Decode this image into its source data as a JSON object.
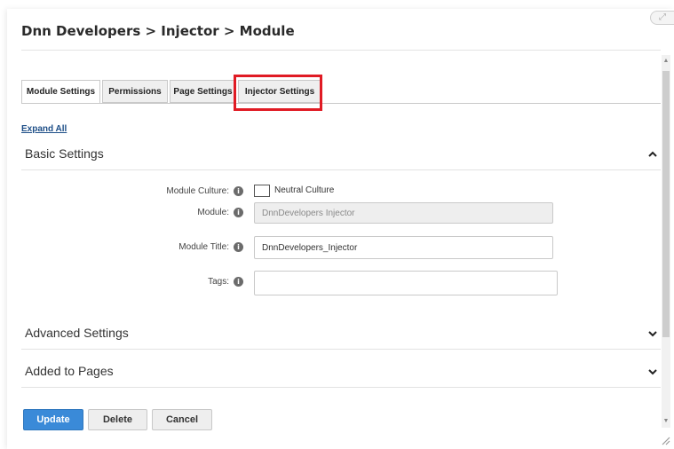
{
  "breadcrumb": "Dnn Developers > Injector > Module",
  "tabs": [
    {
      "label": "Module Settings",
      "active": true
    },
    {
      "label": "Permissions",
      "active": false
    },
    {
      "label": "Page Settings",
      "active": false
    },
    {
      "label": "Injector Settings",
      "active": false
    }
  ],
  "expand_all": "Expand All",
  "sections": {
    "basic": {
      "title": "Basic Settings",
      "icon": "chevron-up-icon"
    },
    "advanced": {
      "title": "Advanced Settings",
      "icon": "chevron-down-icon"
    },
    "added_to_pages": {
      "title": "Added to Pages",
      "icon": "chevron-down-icon"
    }
  },
  "fields": {
    "module_culture": {
      "label": "Module Culture:",
      "checkbox_label": "Neutral Culture",
      "checked": false
    },
    "module": {
      "label": "Module:",
      "value": "DnnDevelopers Injector"
    },
    "module_title": {
      "label": "Module Title:",
      "value": "DnnDevelopers_Injector"
    },
    "tags": {
      "label": "Tags:",
      "value": ""
    }
  },
  "info_icon_glyph": "i",
  "buttons": {
    "update": "Update",
    "delete": "Delete",
    "cancel": "Cancel"
  },
  "colors": {
    "highlight": "#e01b24",
    "primary_button": "#3a8ad8",
    "link": "#1d4e87"
  }
}
